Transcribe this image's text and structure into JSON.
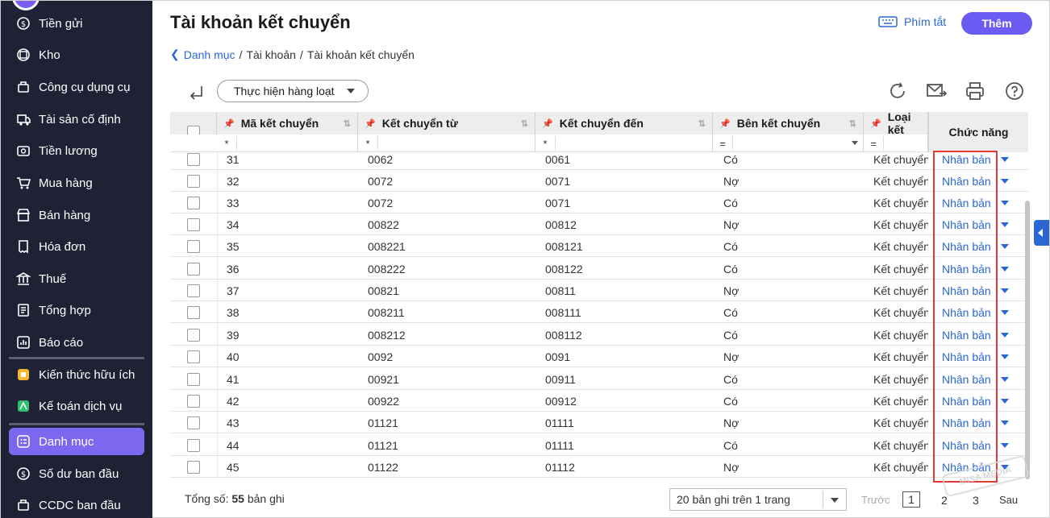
{
  "sidebar": {
    "items": [
      {
        "label": "Tiền gửi",
        "icon": "deposit-icon"
      },
      {
        "label": "Kho",
        "icon": "warehouse-icon"
      },
      {
        "label": "Công cụ dụng cụ",
        "icon": "tools-icon"
      },
      {
        "label": "Tài sản cố định",
        "icon": "truck-icon"
      },
      {
        "label": "Tiền lương",
        "icon": "salary-icon"
      },
      {
        "label": "Mua hàng",
        "icon": "cart-icon"
      },
      {
        "label": "Bán hàng",
        "icon": "store-icon"
      },
      {
        "label": "Hóa đơn",
        "icon": "invoice-icon"
      },
      {
        "label": "Thuế",
        "icon": "bank-icon"
      },
      {
        "label": "Tổng hợp",
        "icon": "report-icon"
      },
      {
        "label": "Báo cáo",
        "icon": "chart-icon"
      }
    ],
    "extras": [
      {
        "label": "Kiến thức hữu ích",
        "icon": "knowledge-icon"
      },
      {
        "label": "Kế toán dịch vụ",
        "icon": "service-icon"
      }
    ],
    "bottom": [
      {
        "label": "Danh mục",
        "icon": "catalog-icon",
        "active": true
      },
      {
        "label": "Số dư ban đầu",
        "icon": "balance-icon"
      },
      {
        "label": "CCDC ban đầu",
        "icon": "tools-icon"
      }
    ]
  },
  "header": {
    "title": "Tài khoản kết chuyển",
    "shortcut_label": "Phím tắt",
    "add_label": "Thêm"
  },
  "breadcrumb": {
    "root": "Danh mục",
    "sep": "/",
    "middle": "Tài khoản",
    "current": "Tài khoản kết chuyển"
  },
  "toolbar": {
    "bulk_label": "Thực hiện hàng loạt"
  },
  "table": {
    "columns": [
      "Mã kết chuyển",
      "Kết chuyển từ",
      "Kết chuyển đến",
      "Bên kết chuyển",
      "Loại kết"
    ],
    "function_header": "Chức năng",
    "filters": [
      "*",
      "*",
      "*",
      "=",
      "="
    ],
    "action_label": "Nhân bản",
    "rows": [
      {
        "code": "31",
        "from": "0062",
        "to": "0061",
        "side": "Có",
        "type": "Kết chuyển"
      },
      {
        "code": "32",
        "from": "0072",
        "to": "0071",
        "side": "Nợ",
        "type": "Kết chuyển"
      },
      {
        "code": "33",
        "from": "0072",
        "to": "0071",
        "side": "Có",
        "type": "Kết chuyển"
      },
      {
        "code": "34",
        "from": "00822",
        "to": "00812",
        "side": "Nợ",
        "type": "Kết chuyển"
      },
      {
        "code": "35",
        "from": "008221",
        "to": "008121",
        "side": "Có",
        "type": "Kết chuyển"
      },
      {
        "code": "36",
        "from": "008222",
        "to": "008122",
        "side": "Có",
        "type": "Kết chuyển"
      },
      {
        "code": "37",
        "from": "00821",
        "to": "00811",
        "side": "Nợ",
        "type": "Kết chuyển"
      },
      {
        "code": "38",
        "from": "008211",
        "to": "008111",
        "side": "Có",
        "type": "Kết chuyển"
      },
      {
        "code": "39",
        "from": "008212",
        "to": "008112",
        "side": "Có",
        "type": "Kết chuyển"
      },
      {
        "code": "40",
        "from": "0092",
        "to": "0091",
        "side": "Nợ",
        "type": "Kết chuyển"
      },
      {
        "code": "41",
        "from": "00921",
        "to": "00911",
        "side": "Có",
        "type": "Kết chuyển"
      },
      {
        "code": "42",
        "from": "00922",
        "to": "00912",
        "side": "Có",
        "type": "Kết chuyển"
      },
      {
        "code": "43",
        "from": "01121",
        "to": "01111",
        "side": "Nợ",
        "type": "Kết chuyển"
      },
      {
        "code": "44",
        "from": "01121",
        "to": "01111",
        "side": "Có",
        "type": "Kết chuyển"
      },
      {
        "code": "45",
        "from": "01122",
        "to": "01112",
        "side": "Nợ",
        "type": "Kết chuyển"
      }
    ]
  },
  "footer": {
    "total_prefix": "Tổng số:",
    "total_count": "55",
    "total_suffix": "bản ghi",
    "page_size_label": "20 bản ghi trên 1 trang",
    "prev_label": "Trước",
    "pages": [
      "1",
      "2",
      "3"
    ],
    "next_label": "Sau"
  },
  "watermark": "MISA MEDIA",
  "colors": {
    "sidebar_bg": "#1f2234",
    "accent": "#7b68ee",
    "link": "#2a67d4",
    "highlight": "#e53935"
  }
}
